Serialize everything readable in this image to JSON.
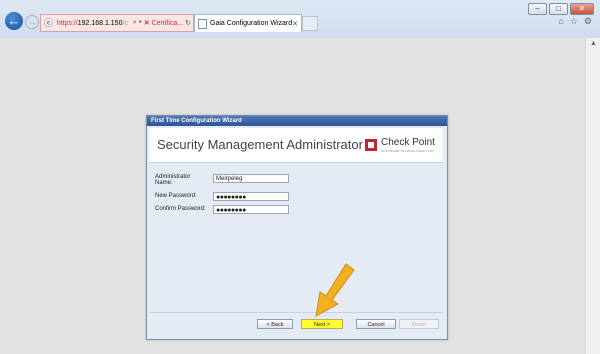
{
  "browser": {
    "address": {
      "scheme": "https://",
      "host": "192.168.1.150",
      "rest": "/c",
      "search_glyph": "⌕ ▾",
      "cert_label": "Certifica...",
      "cert_x": "✕",
      "refresh_glyph": "↻"
    },
    "tab": {
      "label": "Gaia Configuration Wizard",
      "close_glyph": "✕"
    },
    "window_buttons": {
      "min": "–",
      "max": "□",
      "close": "✕"
    },
    "right_icons": [
      "⌂",
      "☆",
      "⚙"
    ],
    "back_glyph": "←",
    "forward_glyph": "→",
    "colors": {
      "accent": "#2d5597",
      "cert_error": "#cc3333",
      "highlight": "#ffff30"
    }
  },
  "wizard": {
    "window_title": "First Time Configuration Wizard",
    "heading": "Security Management Administrator",
    "logo": {
      "brand": "Check Point",
      "tagline": "SOFTWARE TECHNOLOGIES LTD"
    },
    "fields": [
      {
        "label": "Administrator Name:",
        "value": "Meirpeleg"
      },
      {
        "label": "New Password:",
        "value": "●●●●●●●●"
      },
      {
        "label": "Confirm Password:",
        "value": "●●●●●●●●"
      }
    ],
    "buttons": {
      "back": "< Back",
      "next": "Next >",
      "cancel": "Cancel",
      "finish": "Finish"
    }
  },
  "annotation": {
    "icon": "pointing-arrow-icon",
    "color": "#f0b020"
  }
}
